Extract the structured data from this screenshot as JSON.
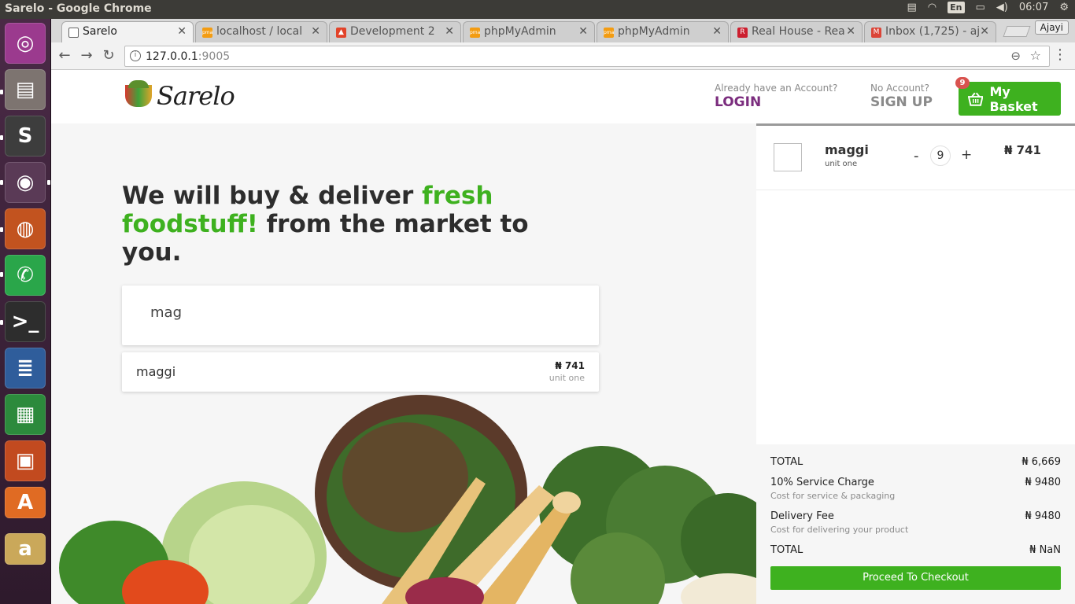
{
  "os": {
    "window_title": "Sarelo - Google Chrome",
    "lang": "En",
    "clock": "06:07",
    "launcher": [
      {
        "name": "ubuntu-logo-icon",
        "color": "#9b3a8e",
        "glyph": "◎"
      },
      {
        "name": "files-icon",
        "color": "#7d7470",
        "glyph": "▤"
      },
      {
        "name": "sublime-text-icon",
        "color": "#3d3d3d",
        "glyph": "S"
      },
      {
        "name": "chrome-icon",
        "color": "#5a3a56",
        "glyph": "◉"
      },
      {
        "name": "firefox-icon",
        "color": "#c2531f",
        "glyph": "◍"
      },
      {
        "name": "whatsapp-icon",
        "color": "#2aa64a",
        "glyph": "✆"
      },
      {
        "name": "terminal-icon",
        "color": "#2d2d2d",
        "glyph": ">_"
      },
      {
        "name": "writer-icon",
        "color": "#2f5d9b",
        "glyph": "≣"
      },
      {
        "name": "calc-icon",
        "color": "#2c8a3c",
        "glyph": "▦"
      },
      {
        "name": "impress-icon",
        "color": "#c24a1f",
        "glyph": "▣"
      },
      {
        "name": "software-center-icon",
        "color": "#e06b23",
        "glyph": "A"
      },
      {
        "name": "amazon-icon",
        "color": "#caa85a",
        "glyph": "a"
      }
    ]
  },
  "browser": {
    "profile": "Ajayi",
    "url_host": "127.0.0.1",
    "url_port": ":9005",
    "tabs": [
      {
        "label": "Sarelo",
        "active": true,
        "favicon": "page",
        "color": "#f2f2f2"
      },
      {
        "label": "localhost / local",
        "active": false,
        "favicon": "pma",
        "color": "#f39c12"
      },
      {
        "label": "Development 2",
        "active": false,
        "favicon": "gitlab",
        "color": "#e24329"
      },
      {
        "label": "phpMyAdmin",
        "active": false,
        "favicon": "pma",
        "color": "#f39c12"
      },
      {
        "label": "phpMyAdmin",
        "active": false,
        "favicon": "pma",
        "color": "#f39c12"
      },
      {
        "label": "Real House - Rea",
        "active": false,
        "favicon": "R",
        "color": "#cc1f2f"
      },
      {
        "label": "Inbox (1,725) - aj",
        "active": false,
        "favicon": "M",
        "color": "#db4437"
      }
    ]
  },
  "site": {
    "brand": "Sarelo",
    "login_hint": "Already have an Account?",
    "login_label": "LOGIN",
    "signup_hint": "No Account?",
    "signup_label": "SIGN UP",
    "basket_label": "My Basket",
    "basket_count": "9",
    "headline_part1": "We will buy & deliver ",
    "headline_green": "fresh foodstuff!",
    "headline_part2": " from the market to you.",
    "search_value": "mag",
    "suggestion": {
      "name": "maggi",
      "price": "₦ 741",
      "unit": "unit one"
    }
  },
  "cart": {
    "items": [
      {
        "name": "maggi",
        "unit": "unit one",
        "qty": "9",
        "price": "₦ 741",
        "minus": "-",
        "plus": "+"
      }
    ],
    "subtotal_label": "TOTAL",
    "subtotal_value": "₦ 6,669",
    "service_label": "10% Service Charge",
    "service_value": "₦ 9480",
    "service_sub": "Cost for service & packaging",
    "delivery_label": "Delivery Fee",
    "delivery_value": "₦ 9480",
    "delivery_sub": "Cost for delivering your product",
    "total_label": "TOTAL",
    "total_value": "₦ NaN",
    "checkout_label": "Proceed To Checkout"
  },
  "colors": {
    "brand_green": "#3eb11f",
    "login_purple": "#7b2d7e",
    "badge_red": "#d9534f"
  }
}
